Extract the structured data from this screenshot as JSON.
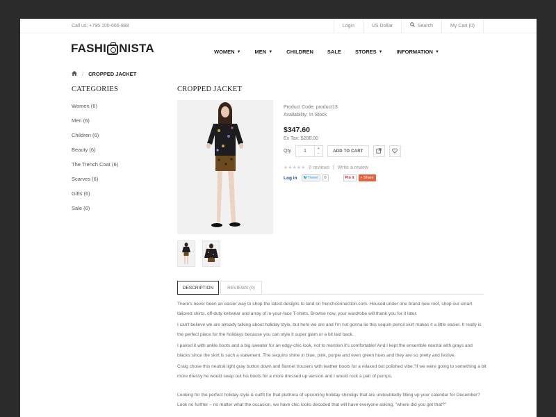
{
  "topbar": {
    "call": "Call us: +795 100-666-888",
    "login": "Login",
    "currency": "US Dollar",
    "search": "Search",
    "cart": "My Cart (0)"
  },
  "logo": {
    "part1": "FASHI",
    "part2": "NISTA"
  },
  "nav": [
    "WOMEN",
    "MEN",
    "CHILDREN",
    "SALE",
    "STORES",
    "INFORMATION"
  ],
  "breadcrumb": {
    "current": "CROPPED JACKET",
    "sep": "/"
  },
  "sidebar": {
    "title": "CATEGORIES",
    "items": [
      "Women (6)",
      "Men (6)",
      "Children (6)",
      "Beauty (6)",
      "The Trench Coat (6)",
      "Scarves (6)",
      "Gifts (6)",
      "Sale (6)"
    ]
  },
  "product": {
    "title": "CROPPED JACKET",
    "code": "Product Code: product13",
    "availability": "Availability: In Stock",
    "price": "$347.60",
    "ex_tax": "Ex Tax: $288.00",
    "qty_label": "Qty",
    "qty_value": "1",
    "add_to_cart": "ADD TO CART",
    "reviews": "0 reviews",
    "write_review": "Write a review",
    "social_login": "Log in",
    "tweet": "Tweet",
    "tweet_count": "0",
    "pin": "Pin it",
    "share": "Share"
  },
  "tabs": {
    "description": "DESCRIPTION",
    "reviews": "REVIEWS (0)"
  },
  "description": [
    "There's never been an easier way to shop the latest designs to land on frenchconnection.com. Housed under one brand new roof, shop our smart tailored shirts, off-duty knitwear and array of in-your-face T-shirts. Browse now, your wardrobe will thank you for it later.",
    "I can't believe we are already talking about holiday style, but here we are and I'm not gonna lie this sequin pencil skirt makes it a little easier. It really is the perfect piece for the holidays because you can style it super glam or a bit laid back.",
    "I paired it with ankle boots and a big sweater for an edgy-chic look, not to mention it's comfortable! And I kept the ensemble neutral with grays and blacks since the skirt is such a statement. The sequins shine in blue, pink, purple and even green hues and they are so pretty and festive.",
    "Craig chose this neutral light gray button down and flannel trousers with leather boots for a relaxed but polished vibe.\"If we were going to something a bit more dressy he would swap out his boots for a more dressed up version and I would rock a pair of pumps.",
    "Looking for the perfect holiday style & outfit for that plethora of upcoming holiday shindigs that are undoubtedly filling up your calendar for December? Look no further – no matter what the occasion, we have chic looks decoded that will have everyone asking, \"where did you get that?\""
  ]
}
